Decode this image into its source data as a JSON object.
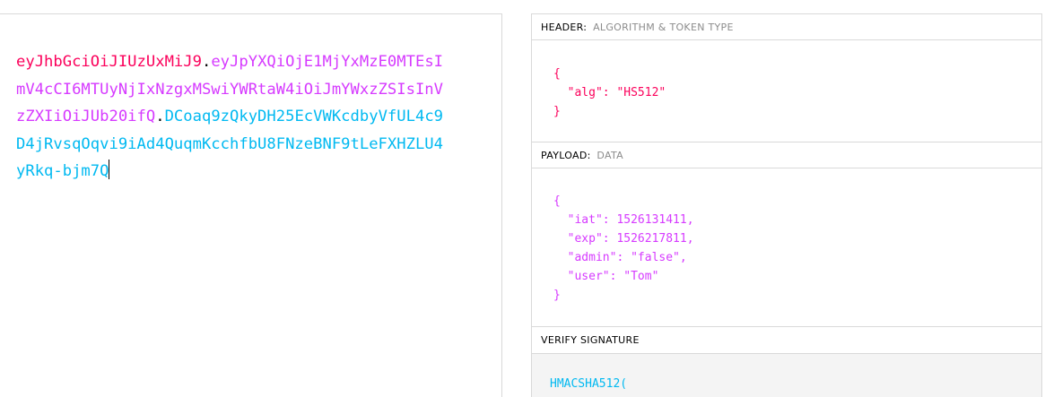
{
  "encoded": {
    "header_part": "eyJhbGciOiJIUzUxMiJ9",
    "dot1": ".",
    "payload_part": "eyJpYXQiOjE1MjYxMzE0MTEsImV4cCI6MTUyNjIxNzgxMSwiYWRtaW4iOiJmYWxzZSIsInVzZXIiOiJUb20ifQ",
    "dot2": ".",
    "signature_part": "DCoaq9zQkyDH25EcVWKcdbyVfUL4c9D4jRvsqOqvi9iAd4QuqmKcchfbU8FNzeBNF9tLeFXHZLU4yRkq-bjm7Q"
  },
  "decoded": {
    "header_section": {
      "title": "HEADER:",
      "subtitle": "ALGORITHM & TOKEN TYPE",
      "lines": [
        "{",
        "  \"alg\": \"HS512\"",
        "}"
      ]
    },
    "payload_section": {
      "title": "PAYLOAD:",
      "subtitle": "DATA",
      "lines": [
        "{",
        "  \"iat\": 1526131411,",
        "  \"exp\": 1526217811,",
        "  \"admin\": \"false\",",
        "  \"user\": \"Tom\"",
        "}"
      ]
    },
    "verify_section": {
      "title": "VERIFY SIGNATURE",
      "function_text": "HMACSHA512("
    }
  },
  "colors": {
    "header": "#fb015b",
    "payload": "#d63aff",
    "signature": "#00b9f1"
  }
}
